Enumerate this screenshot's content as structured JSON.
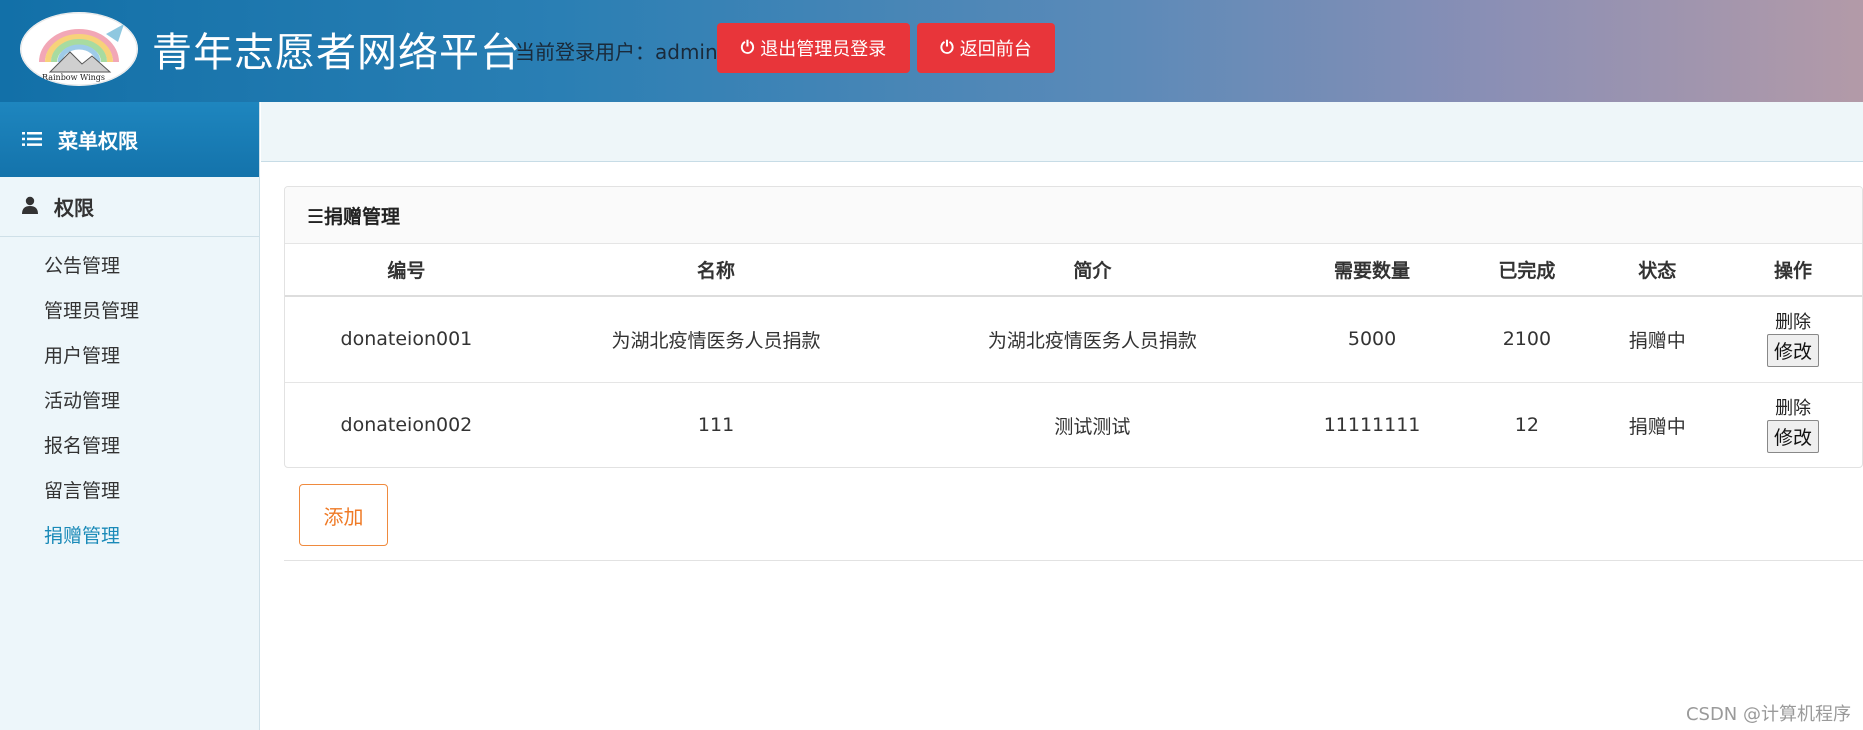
{
  "header": {
    "logo_text": "Rainbow Wings",
    "site_title": "青年志愿者网络平台",
    "login_label": "当前登录用户：admin",
    "logout_button": "退出管理员登录",
    "front_button": "返回前台"
  },
  "sidebar": {
    "head": "菜单权限",
    "group": "权限",
    "items": [
      {
        "label": "公告管理"
      },
      {
        "label": "管理员管理"
      },
      {
        "label": "用户管理"
      },
      {
        "label": "活动管理"
      },
      {
        "label": "报名管理"
      },
      {
        "label": "留言管理"
      },
      {
        "label": "捐赠管理",
        "active": true
      }
    ]
  },
  "panel": {
    "title": "☰捐赠管理",
    "columns": [
      "编号",
      "名称",
      "简介",
      "需要数量",
      "已完成",
      "状态",
      "操作"
    ],
    "rows": [
      {
        "id": "donateion001",
        "name": "为湖北疫情医务人员捐款",
        "desc": "为湖北疫情医务人员捐款",
        "need": "5000",
        "done": "2100",
        "status": "捐赠中",
        "delete": "删除",
        "edit": "修改"
      },
      {
        "id": "donateion002",
        "name": "111",
        "desc": "测试测试",
        "need": "11111111",
        "done": "12",
        "status": "捐赠中",
        "delete": "删除",
        "edit": "修改"
      }
    ]
  },
  "add_button": "添加",
  "watermark": "CSDN @计算机程序",
  "colors": {
    "accent_red": "#e8353a",
    "sidebar_active": "#1a8ab8",
    "add_orange": "#ef7a26"
  }
}
